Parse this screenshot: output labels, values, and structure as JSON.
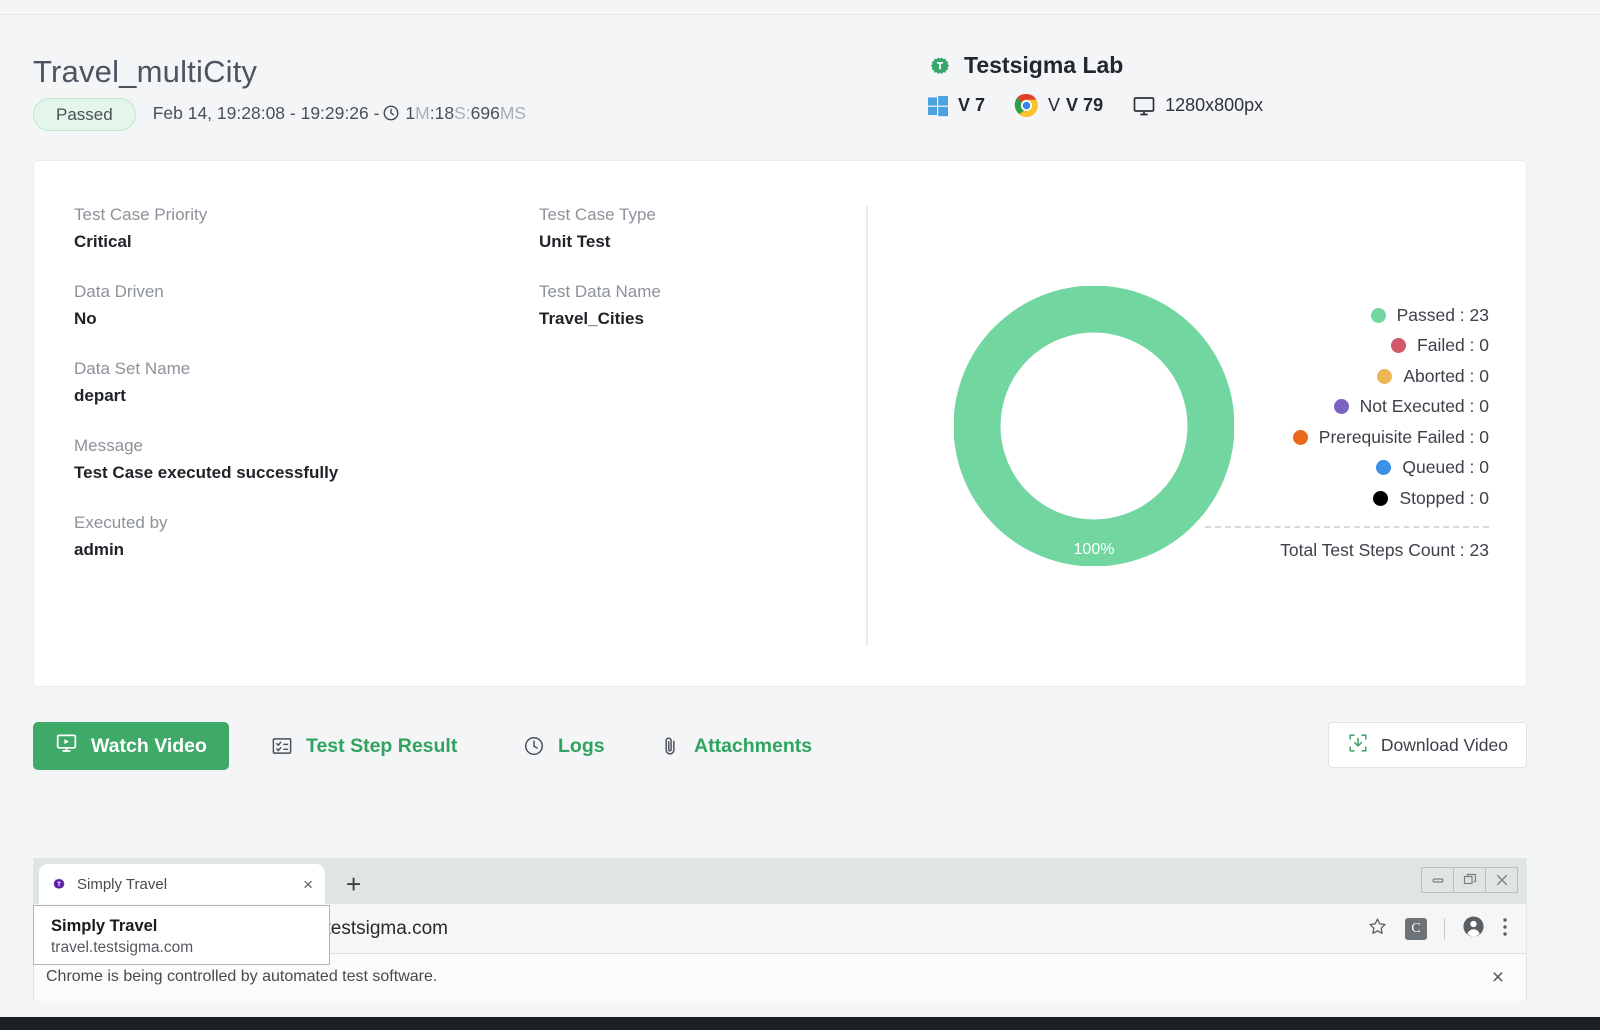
{
  "header": {
    "title": "Travel_multiCity",
    "status_badge": "Passed",
    "timestamp": "Feb 14, 19:28:08 - 19:29:26 -",
    "duration_min": "1",
    "duration_min_unit": "M",
    "duration_sep": ":",
    "duration_sec": "18",
    "duration_sec_unit": "S:",
    "duration_ms": "696",
    "duration_ms_unit": "MS",
    "lab_name": "Testsigma Lab",
    "os_version": "V 7",
    "browser_version": "V 79",
    "resolution": "1280x800px"
  },
  "details": [
    {
      "label": "Test Case Priority",
      "value": "Critical"
    },
    {
      "label": "Test Case Type",
      "value": "Unit Test"
    },
    {
      "label": "Data Driven",
      "value": "No"
    },
    {
      "label": "Test Data Name",
      "value": "Travel_Cities"
    },
    {
      "label": "Data Set Name",
      "value": "depart"
    },
    {
      "label": "Message",
      "value": "Test Case executed successfully"
    },
    {
      "label": "Executed by",
      "value": "admin"
    }
  ],
  "chart_data": {
    "type": "pie",
    "title": "",
    "center_label": "100%",
    "legend_position": "right",
    "categories": [
      "Passed",
      "Failed",
      "Aborted",
      "Not Executed",
      "Prerequisite Failed",
      "Queued",
      "Stopped"
    ],
    "values": [
      23,
      0,
      0,
      0,
      0,
      0,
      0
    ],
    "colors": [
      "#72d6a0",
      "#d1596b",
      "#eeb657",
      "#7a62c4",
      "#ea6a1b",
      "#3b90e8",
      "#000000"
    ],
    "legend_labels": [
      "Passed : 23",
      "Failed : 0",
      "Aborted : 0",
      "Not Executed : 0",
      "Prerequisite Failed : 0",
      "Queued : 0",
      "Stopped : 0"
    ],
    "total_label": "Total Test Steps Count : 23",
    "total": 23
  },
  "actions": {
    "watch_video": "Watch Video",
    "test_step_result": "Test Step Result",
    "logs": "Logs",
    "attachments": "Attachments",
    "download_video": "Download Video"
  },
  "browser": {
    "tab_title": "Simply Travel",
    "tab_close": "×",
    "new_tab": "+",
    "url": "l.testsigma.com",
    "infobar_text": "Chrome is being controlled by automated test software.",
    "infobar_close": "×",
    "extension_letter": "C",
    "tooltip_title": "Simply Travel",
    "tooltip_url": "travel.testsigma.com"
  },
  "colors": {
    "accent_green": "#3fa968",
    "link_green": "#2fa35f",
    "chart_green": "#72d6a0",
    "page_bg": "#f4f5f7"
  }
}
